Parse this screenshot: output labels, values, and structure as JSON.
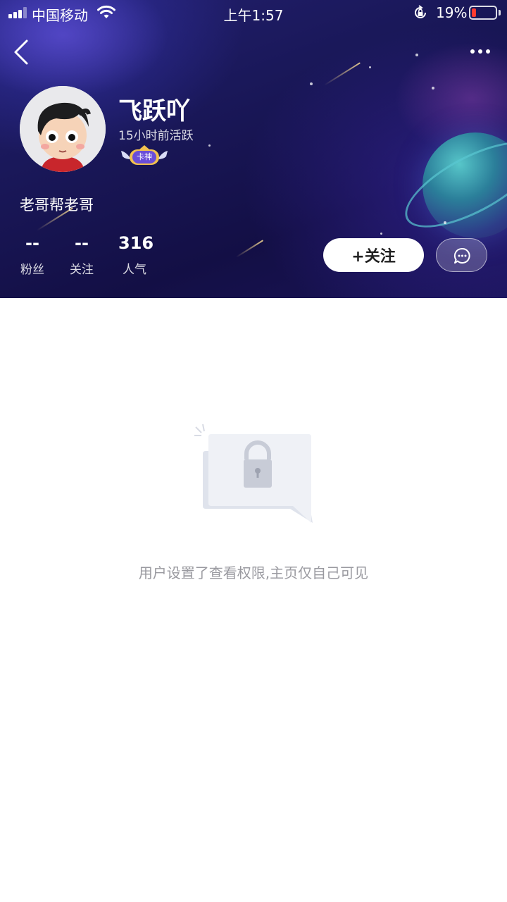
{
  "status_bar": {
    "carrier": "中国移动",
    "time": "上午1:57",
    "battery_percent": "19%",
    "battery_level": 0.19,
    "icons": [
      "signal-icon",
      "wifi-icon",
      "orientation-lock-icon",
      "battery-icon"
    ]
  },
  "nav": {
    "back_icon": "chevron-left-icon",
    "more_icon": "more-dots-icon"
  },
  "profile": {
    "username": "飞跃吖",
    "active_time": "15小时前活跃",
    "badge": "卡神",
    "bio": "老哥帮老哥"
  },
  "stats": [
    {
      "value": "--",
      "label": "粉丝"
    },
    {
      "value": "--",
      "label": "关注"
    },
    {
      "value": "316",
      "label": "人气"
    }
  ],
  "actions": {
    "follow_label": "+关注",
    "chat_icon": "chat-bubble-icon"
  },
  "empty_state": {
    "icon": "lock-icon",
    "message": "用户设置了查看权限,主页仅自己可见"
  },
  "colors": {
    "header_bg": "#1a185a",
    "battery_low": "#ff3b30",
    "empty_text": "#9a9aa0"
  }
}
